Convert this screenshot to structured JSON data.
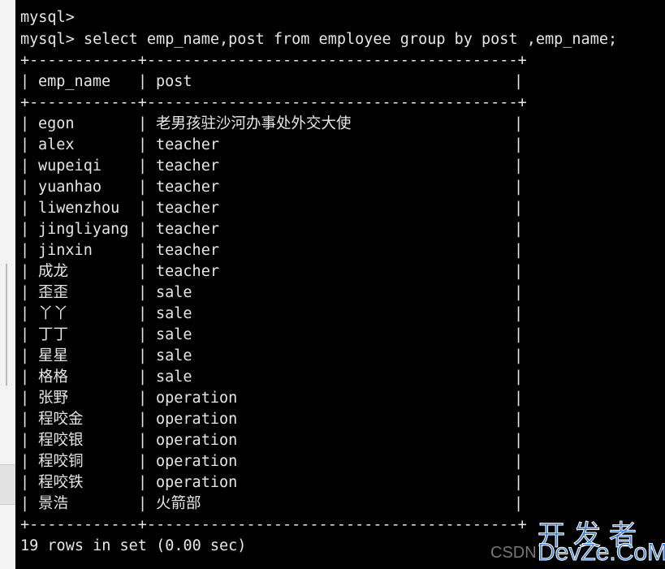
{
  "terminal": {
    "prompt_line": "mysql>",
    "command_line": "mysql> select emp_name,post from employee group by post ,emp_name;",
    "border": "+------------+-----------------------------------------+",
    "columns": [
      "emp_name",
      "post"
    ],
    "rows": [
      [
        "egon",
        "老男孩驻沙河办事处外交大使"
      ],
      [
        "alex",
        "teacher"
      ],
      [
        "wupeiqi",
        "teacher"
      ],
      [
        "yuanhao",
        "teacher"
      ],
      [
        "liwenzhou",
        "teacher"
      ],
      [
        "jingliyang",
        "teacher"
      ],
      [
        "jinxin",
        "teacher"
      ],
      [
        "成龙",
        "teacher"
      ],
      [
        "歪歪",
        "sale"
      ],
      [
        "丫丫",
        "sale"
      ],
      [
        "丁丁",
        "sale"
      ],
      [
        "星星",
        "sale"
      ],
      [
        "格格",
        "sale"
      ],
      [
        "张野",
        "operation"
      ],
      [
        "程咬金",
        "operation"
      ],
      [
        "程咬银",
        "operation"
      ],
      [
        "程咬铜",
        "operation"
      ],
      [
        "程咬铁",
        "operation"
      ],
      [
        "景浩",
        "火箭部"
      ]
    ],
    "footer": "19 rows in set (0.00 sec)"
  },
  "watermark": {
    "site_cn": "开发者",
    "site": "DevZe.CoM",
    "csdn": "CSDN"
  }
}
